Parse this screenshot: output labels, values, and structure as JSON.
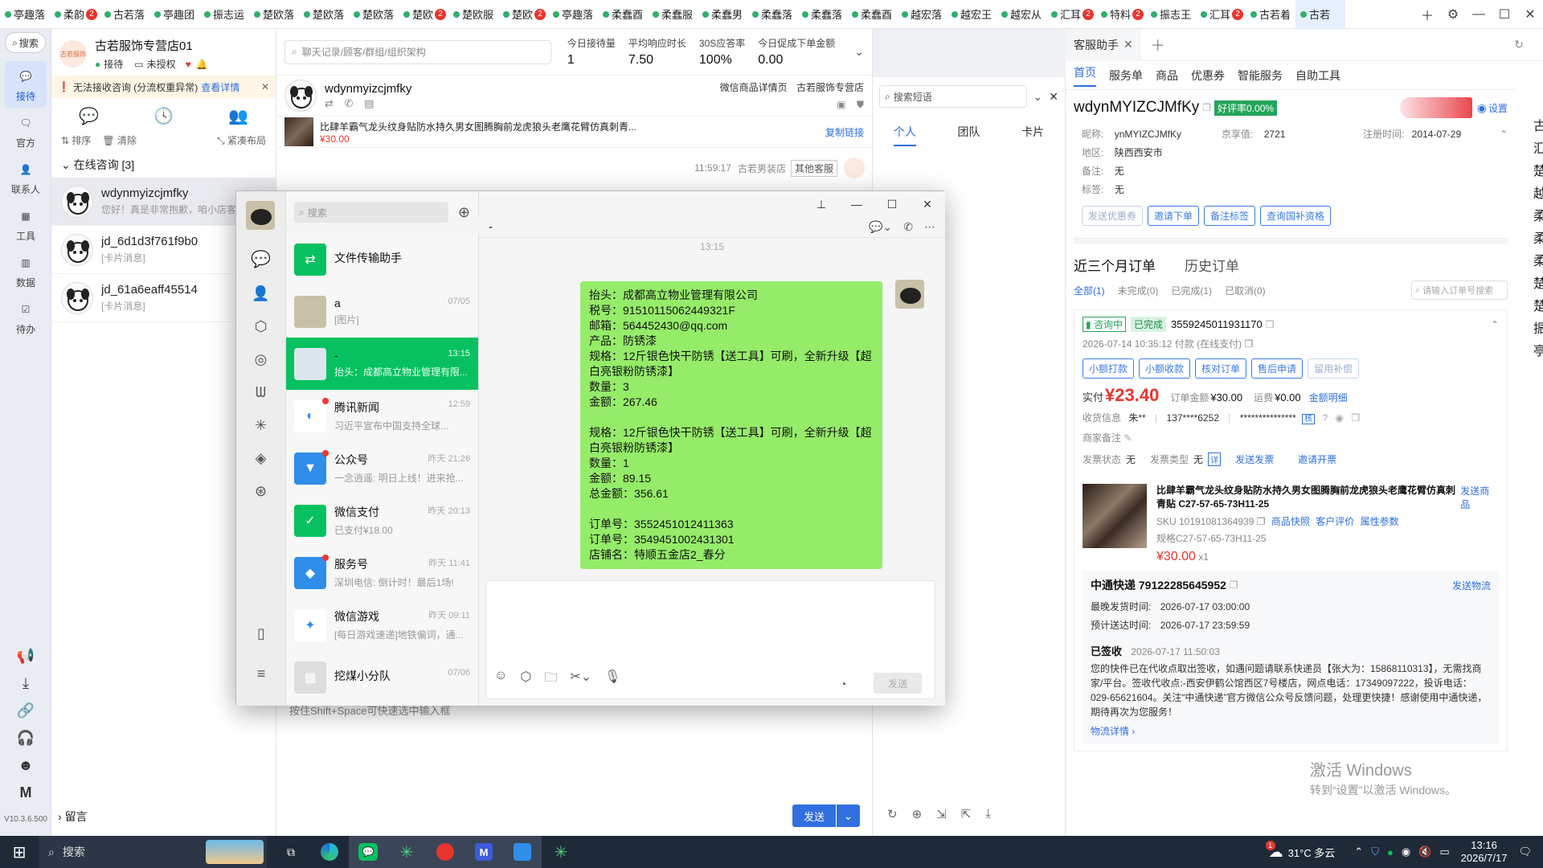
{
  "tabs": [
    {
      "label": "亭趣落",
      "badge": ""
    },
    {
      "label": "柔韵",
      "badge": "2"
    },
    {
      "label": "古若落",
      "badge": ""
    },
    {
      "label": "亭趣团",
      "badge": ""
    },
    {
      "label": "振志运",
      "badge": ""
    },
    {
      "label": "楚欧落",
      "badge": ""
    },
    {
      "label": "楚欧落",
      "badge": ""
    },
    {
      "label": "楚欧落",
      "badge": ""
    },
    {
      "label": "楚欧",
      "badge": "2"
    },
    {
      "label": "楚欧服",
      "badge": ""
    },
    {
      "label": "楚欧",
      "badge": "2"
    },
    {
      "label": "亭趣落",
      "badge": ""
    },
    {
      "label": "柔蠢酉",
      "badge": ""
    },
    {
      "label": "柔蠢服",
      "badge": ""
    },
    {
      "label": "柔蠢男",
      "badge": ""
    },
    {
      "label": "柔蠢落",
      "badge": ""
    },
    {
      "label": "柔蠢落",
      "badge": ""
    },
    {
      "label": "柔蠢酉",
      "badge": ""
    },
    {
      "label": "越宏落",
      "badge": ""
    },
    {
      "label": "越宏王",
      "badge": ""
    },
    {
      "label": "越宏从",
      "badge": ""
    },
    {
      "label": "汇耳",
      "badge": "2"
    },
    {
      "label": "特料",
      "badge": "2"
    },
    {
      "label": "振志王",
      "badge": ""
    },
    {
      "label": "汇耳",
      "badge": "2"
    },
    {
      "label": "古若着",
      "badge": ""
    },
    {
      "label": "古若",
      "badge": ""
    }
  ],
  "rail": {
    "search": "搜索",
    "items": [
      {
        "label": "接待",
        "icon": "chat-icon"
      },
      {
        "label": "官方",
        "icon": "message-icon"
      },
      {
        "label": "联系人",
        "icon": "contacts-icon"
      },
      {
        "label": "工具",
        "icon": "tools-icon"
      },
      {
        "label": "数据",
        "icon": "chart-icon"
      },
      {
        "label": "待办",
        "icon": "todo-icon"
      }
    ],
    "version": "V10.3.6.500"
  },
  "shop": {
    "name": "古若服饰专营店01",
    "status": "接待",
    "auth": "未授权",
    "avatar_text": "古若服饰"
  },
  "alert": {
    "text": "无法接收咨询 (分流权重异常)",
    "link": "查看详情"
  },
  "sort": {
    "sort": "排序",
    "clear": "清除",
    "layout": "紧凑布局"
  },
  "online": {
    "title": "在线咨询 [3]"
  },
  "contacts": [
    {
      "name": "wdynmyizcjmfky",
      "sub": "您好！真是非常抱歉，咱小店客"
    },
    {
      "name": "jd_6d1d3f761f9b0",
      "sub": "[卡片消息]"
    },
    {
      "name": "jd_61a6eaff45514",
      "sub": "[卡片消息]"
    }
  ],
  "leave_msg": "留言",
  "chat": {
    "search_placeholder": "聊天记录/顾客/群组/组织架构",
    "stats": [
      {
        "label": "今日接待量",
        "value": "1"
      },
      {
        "label": "平均响应时长",
        "value": "7.50"
      },
      {
        "label": "30S应答率",
        "value": "100%"
      },
      {
        "label": "今日促成下单金额",
        "value": "0.00"
      }
    ],
    "customer": "wdynmyizcjmfky",
    "product_detail": "微信商品详情页",
    "shop_name": "古若服饰专营店",
    "product_title": "比肆羊霸气龙头纹身贴防水持久男女图腾胸前龙虎狼头老鹰花臂仿真刺青...",
    "product_price": "¥30.00",
    "copy_link": "复制链接",
    "msg_time": "11:59:17",
    "msg_shop": "古若男装店",
    "msg_tag": "其他客服",
    "input_hint": "按住Shift+Space可快速选中输入框",
    "send": "发送"
  },
  "quick": {
    "search_placeholder": "搜索短语",
    "tabs": [
      "个人",
      "团队",
      "卡片"
    ]
  },
  "assist": {
    "tab_title": "客服助手",
    "nav": [
      "首页",
      "服务单",
      "商品",
      "优惠券",
      "智能服务",
      "自助工具"
    ],
    "username": "wdynMYIZCJMfKy",
    "good_rate": "好评率0.00%",
    "setting": "设置",
    "nick_label": "昵称:",
    "nick": "ynMYIZCJMfKy",
    "jx_label": "京享值:",
    "jx": "2721",
    "reg_label": "注册时间:",
    "reg": "2014-07-29",
    "area_label": "地区:",
    "area": "陕西西安市",
    "note_label": "备注:",
    "note": "无",
    "tag_label": "标签:",
    "tag": "无",
    "actions": [
      "发送优惠券",
      "邀请下单",
      "备注标签",
      "查询国补资格"
    ],
    "orders_tab": "近三个月订单",
    "history_tab": "历史订单",
    "filters": [
      "全部(1)",
      "未完成(0)",
      "已完成(1)",
      "已取消(0)"
    ],
    "order_search": "请输入订单号搜索",
    "order": {
      "consult": "咨询中",
      "done": "已完成",
      "no": "3559245011931170",
      "paytime": "2026-07-14 10:35:12 付款 (在线支付)",
      "btns": [
        "小额打款",
        "小额收款",
        "核对订单",
        "售后申请",
        "留用补偿"
      ],
      "paid_label": "实付",
      "paid": "¥23.40",
      "amount_label": "订单金额",
      "amount": "¥30.00",
      "freight_label": "运费",
      "freight": "¥0.00",
      "amount_detail": "金额明细",
      "recv_label": "收货信息",
      "recv_name": "朱**",
      "recv_phone": "137****6252",
      "recv_addr": "***************",
      "verify": "核",
      "merchant_note": "商家备注",
      "inv_status_label": "发票状态",
      "inv_status": "无",
      "inv_type_label": "发票类型",
      "inv_type": "无",
      "inv_detail": "详",
      "send_invoice": "发送发票",
      "invite_invoice": "邀请开票",
      "goods_title": "比肆羊霸气龙头纹身贴防水持久男女图腾胸前龙虎狼头老鹰花臂仿真刺青贴 C27-57-65-73H11-25",
      "send_goods": "发送商品",
      "sku": "SKU 10191081364939",
      "snapshot": "商品快照",
      "review": "客户评价",
      "attrs": "属性参数",
      "spec": "规格C27-57-65-73H11-25",
      "goods_price": "¥30.00",
      "qty": "x1"
    },
    "logistics": {
      "title": "中通快递 79122285645952",
      "send": "发送物流",
      "latest_label": "最晚发货时间:",
      "latest": "2026-07-17 03:00:00",
      "eta_label": "预计送达时间:",
      "eta": "2026-07-17 23:59:59",
      "status": "已签收",
      "status_time": "2026-07-17 11:50:03",
      "detail": "您的快件已在代收点取出签收，如遇问题请联系快递员【张大为：15868110313】，无需找商家/平台。签收代收点:-西安伊鹤公馆西区7号楼店，网点电话：17349097222，投诉电话：029-65621604。关注“中通快递”官方微信公众号反馈问题，处理更快捷！感谢使用中通快递，期待再次为您服务！",
      "more": "物流详情"
    },
    "side_chars": [
      "古",
      "汇",
      "楚",
      "越",
      "柔",
      "柔",
      "柔",
      "楚",
      "楚",
      "振",
      "亭"
    ]
  },
  "wechat": {
    "search": "搜索",
    "chat_title": "-",
    "time_marker": "13:15",
    "chats": [
      {
        "name": "文件传输助手",
        "sub": "",
        "time": "",
        "icon": "file-transfer-icon"
      },
      {
        "name": "a",
        "sub": "[图片]",
        "time": "07/05",
        "icon": "avatar-a"
      },
      {
        "name": "-",
        "sub": "抬头：成都高立物业管理有限...",
        "time": "13:15",
        "icon": "avatar-dash"
      },
      {
        "name": "腾讯新闻",
        "sub": "习近平宣布中国支持全球...",
        "time": "12:59",
        "icon": "tencent-news-icon"
      },
      {
        "name": "公众号",
        "sub": "一念逍遥: 明日上线！进来抢...",
        "time": "昨天 21:26",
        "icon": "official-account-icon"
      },
      {
        "name": "微信支付",
        "sub": "已支付¥18.00",
        "time": "昨天 20:13",
        "icon": "wechat-pay-icon"
      },
      {
        "name": "服务号",
        "sub": "深圳电信: 倒计时！最后1场!",
        "time": "昨天 11:41",
        "icon": "service-account-icon"
      },
      {
        "name": "微信游戏",
        "sub": "[每日游戏速递]地铁偏词，通...",
        "time": "昨天 09:11",
        "icon": "wechat-games-icon"
      },
      {
        "name": "挖煤小分队",
        "sub": "",
        "time": "07/06",
        "icon": "group-icon"
      }
    ],
    "message_lines": [
      "抬头：成都高立物业管理有限公司",
      "税号：91510115062449321F",
      "邮箱：564452430@qq.com",
      "产品：防锈漆",
      "规格：12斤银色快干防锈【送工具】可刷，全新升级【超白亮银粉防锈漆】",
      "数量：3",
      "金额：267.46",
      "",
      "规格：12斤银色快干防锈【送工具】可刷，全新升级【超白亮银粉防锈漆】",
      "数量：1",
      "金额：89.15",
      "总金额：356.61",
      "",
      "订单号：3552451012411363",
      "订单号：3549451002431301",
      "店铺名：特顺五金店2_春分"
    ],
    "send": "发送"
  },
  "watermark": {
    "line1": "激活 Windows",
    "line2": "转到“设置”以激活 Windows。"
  },
  "taskbar": {
    "search": "搜索",
    "weather": "31°C 多云",
    "time": "13:16",
    "date": "2026/7/17",
    "weather_badge": "1"
  },
  "colors": {
    "accent": "#3b7be8",
    "wechat_green": "#07c160",
    "bubble": "#95ec69",
    "price_red": "#e8352e"
  }
}
